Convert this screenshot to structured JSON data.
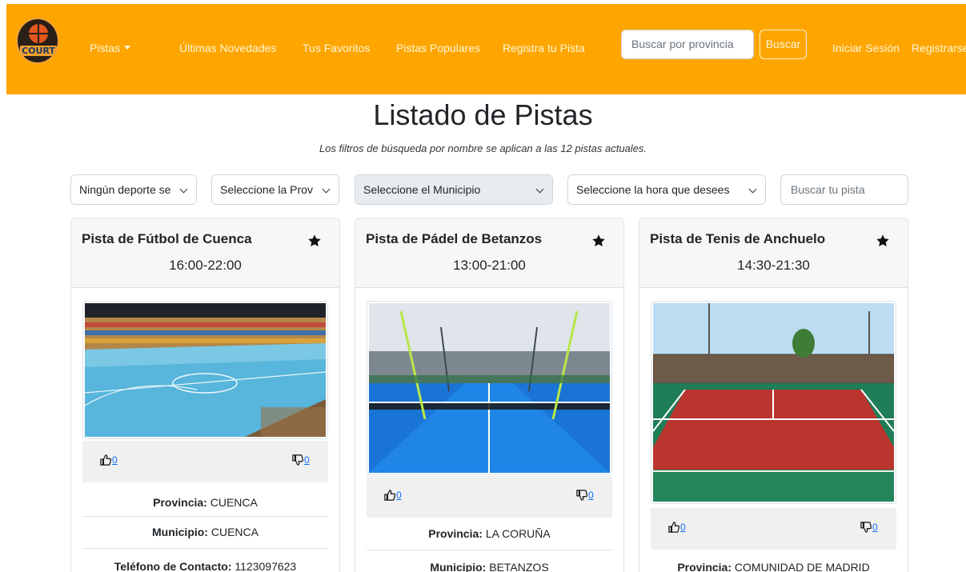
{
  "nav": {
    "brand": "COURT",
    "links": [
      "Pistas",
      "Últimas Novedades",
      "Tus Favoritos",
      "Pistas Populares",
      "Registra tu Pista"
    ],
    "search_placeholder": "Buscar por provincia",
    "search_button": "Buscar",
    "login": "Iniciar Sesión",
    "register": "Registrarse"
  },
  "heading": {
    "title": "Listado de Pistas",
    "subtitle": "Los filtros de búsqueda por nombre se aplican a las 12 pistas actuales."
  },
  "filters": {
    "sport": "Ningún deporte seleccionado",
    "province": "Seleccione la Provincia",
    "municipality": "Seleccione el Municipio",
    "hour": "Seleccione la hora que desees",
    "search_placeholder": "Buscar tu pista"
  },
  "labels": {
    "province": "Provincia:",
    "municipality": "Municipio:",
    "phone": "Teléfono de Contacto:"
  },
  "cards": [
    {
      "title": "Pista de Fútbol de Cuenca",
      "hours": "16:00-22:00",
      "likes": "0",
      "dislikes": "0",
      "province": "CUENCA",
      "municipality": "CUENCA",
      "phone": "1123097623"
    },
    {
      "title": "Pista de Pádel de Betanzos",
      "hours": "13:00-21:00",
      "likes": "0",
      "dislikes": "0",
      "province": "LA CORUÑA",
      "municipality": "BETANZOS"
    },
    {
      "title": "Pista de Tenis de Anchuelo",
      "hours": "14:30-21:30",
      "likes": "0",
      "dislikes": "0",
      "province": "COMUNIDAD DE MADRID"
    }
  ],
  "colors": {
    "navbar": "#ffa500",
    "link": "#0d6efd",
    "header_bg": "#f7f7f7"
  },
  "icons": [
    "basketball-logo-icon",
    "caret-down-icon",
    "star-icon",
    "thumbs-up-icon",
    "thumbs-down-icon",
    "chevron-down-icon"
  ]
}
